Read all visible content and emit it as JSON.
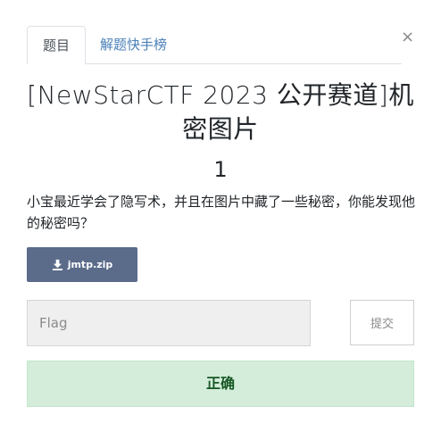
{
  "tabs": [
    {
      "label": "题目"
    },
    {
      "label": "解题快手榜"
    }
  ],
  "close_symbol": "×",
  "challenge": {
    "title": "[NewStarCTF 2023 公开赛道]机密图片",
    "points": "1",
    "description": "小宝最近学会了隐写术，并且在图片中藏了一些秘密，你能发现他的秘密吗？"
  },
  "download": {
    "icon": "download-icon",
    "label": "jmtp.zip"
  },
  "flag_form": {
    "placeholder": "Flag",
    "submit_label": "提交"
  },
  "result": {
    "text": "正确",
    "color": "#d4edda"
  }
}
